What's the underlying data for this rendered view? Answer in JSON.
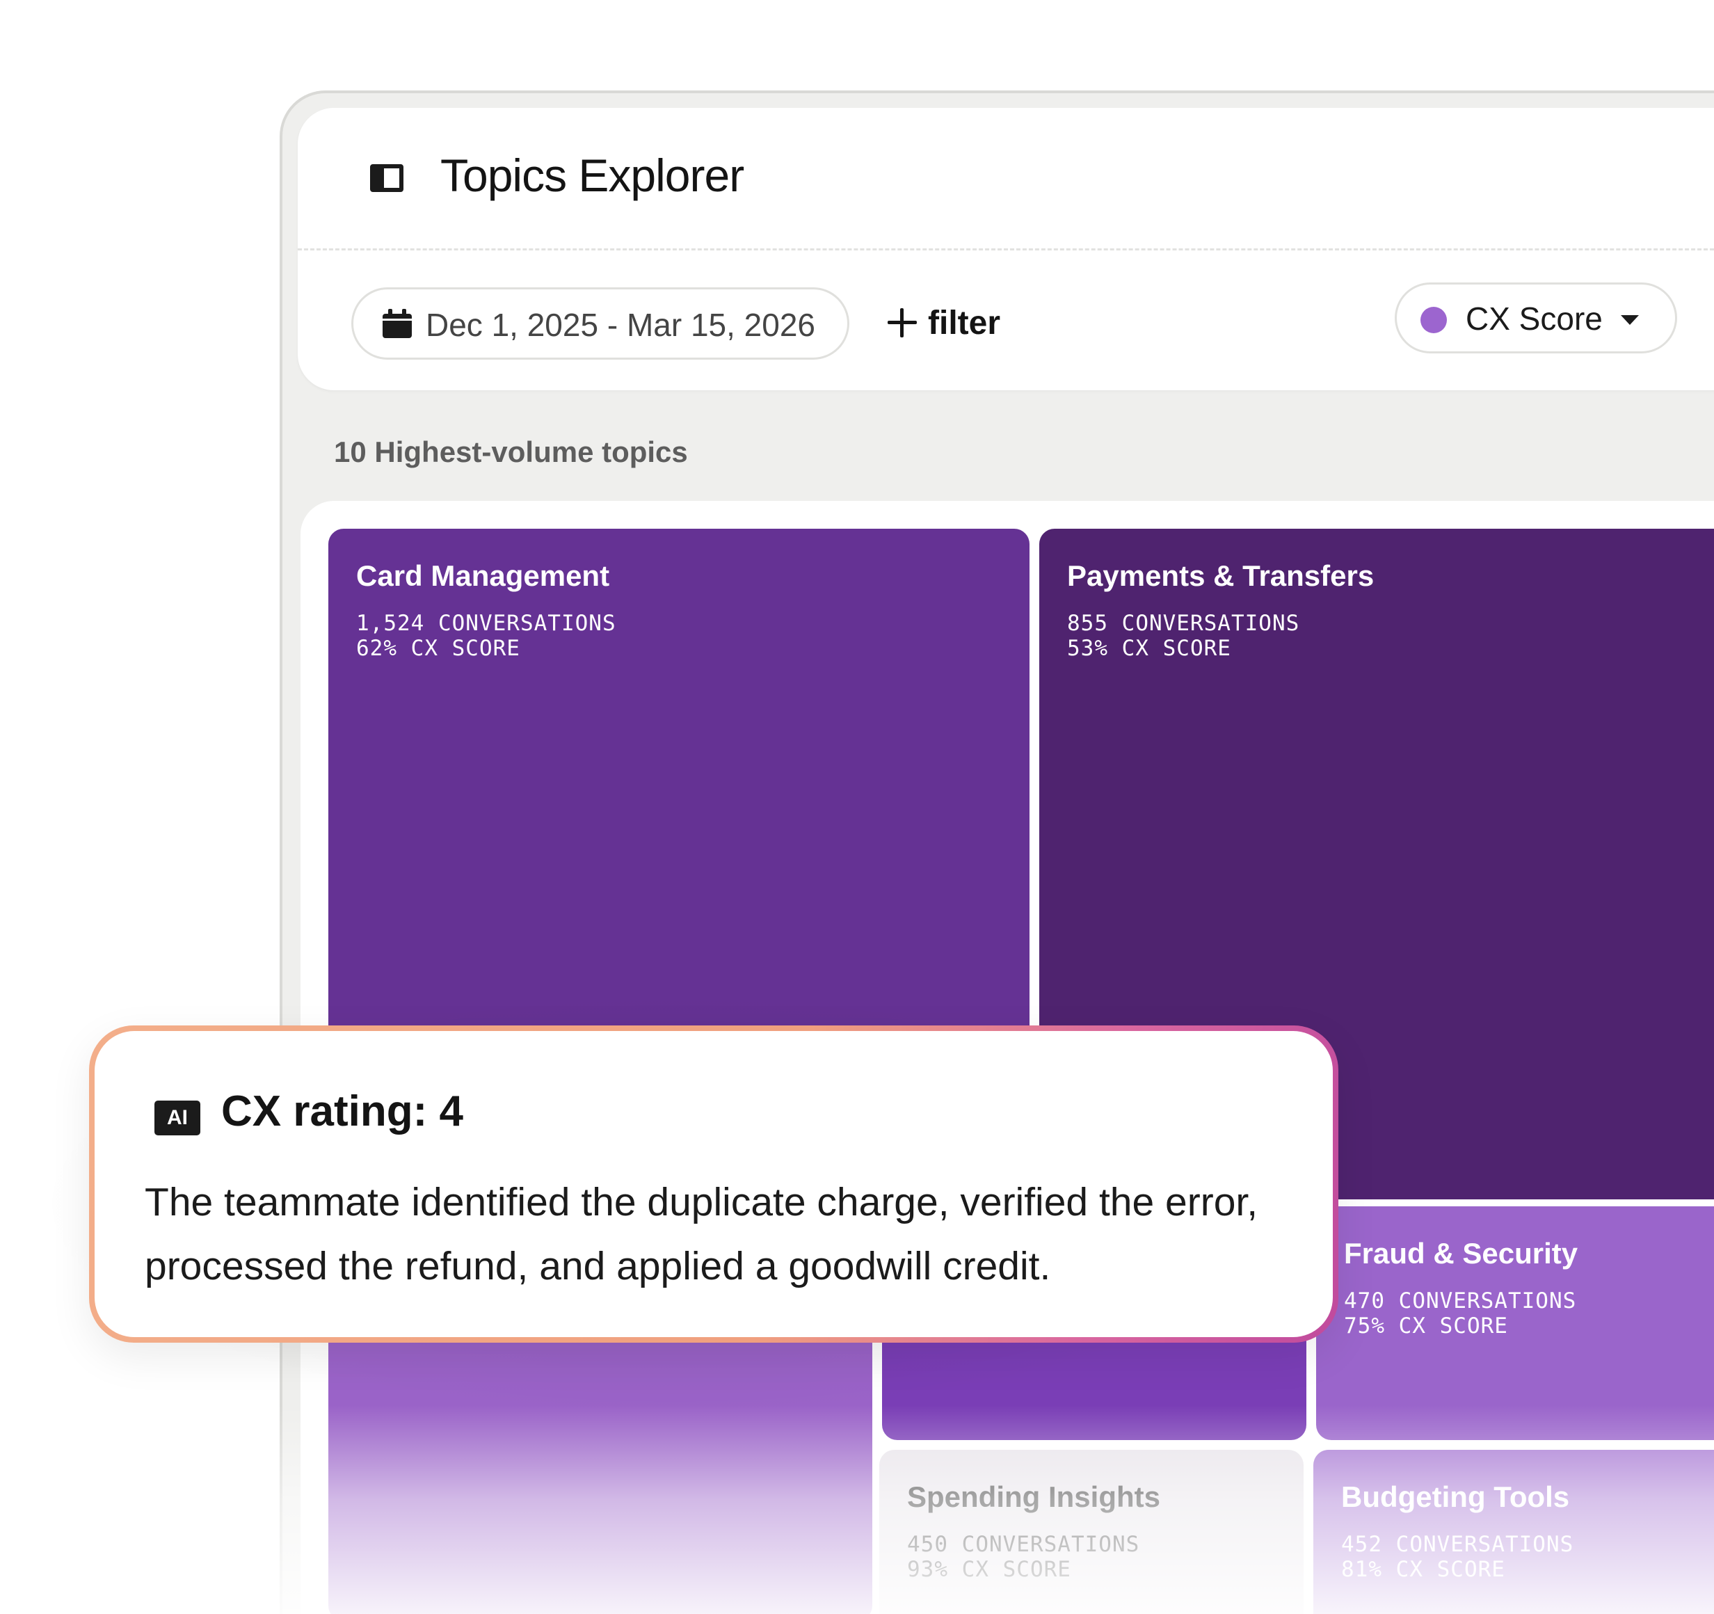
{
  "header": {
    "title": "Topics Explorer"
  },
  "toolbar": {
    "date_range": "Dec 1, 2025 - Mar 15, 2026",
    "filter_label": "filter",
    "metric_label": "CX Score",
    "metric_color": "#9c65cf"
  },
  "section": {
    "label": "10 Highest-volume topics"
  },
  "topics": [
    {
      "name": "Card Management",
      "conversations": "1,524 CONVERSATIONS",
      "cx_score": "62% CX SCORE",
      "color": "#653294"
    },
    {
      "name": "Payments & Transfers",
      "conversations": "855 CONVERSATIONS",
      "cx_score": "53% CX SCORE",
      "color": "#4f236f"
    },
    {
      "name": "Fraud & Security",
      "conversations": "470 CONVERSATIONS",
      "cx_score": "75% CX SCORE",
      "color": "#9a65cb"
    },
    {
      "name": "Spending Insights",
      "conversations": "450 CONVERSATIONS",
      "cx_score": "93% CX SCORE",
      "color": "#e8e4ea"
    },
    {
      "name": "Budgeting Tools",
      "conversations": "452 CONVERSATIONS",
      "cx_score": "81% CX SCORE",
      "color": "#a778d3"
    }
  ],
  "callout": {
    "badge": "AI",
    "title": "CX rating: 4",
    "body": "The teammate identified the duplicate charge, verified the error, processed the refund, and applied a goodwill credit."
  }
}
